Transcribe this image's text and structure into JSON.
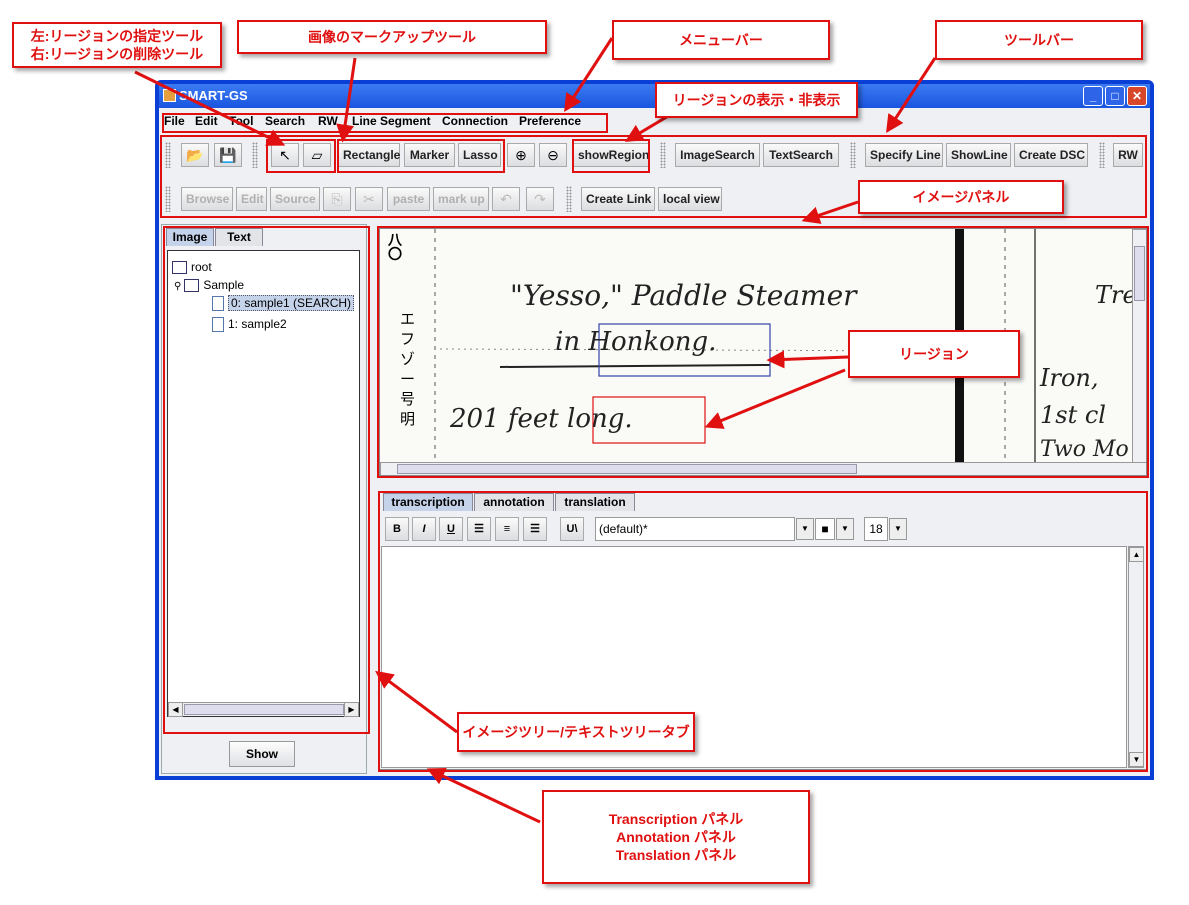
{
  "window": {
    "title": "SMART-GS"
  },
  "menu": [
    "File",
    "Edit",
    "Tool",
    "Search",
    "RW",
    "Line Segment",
    "Connection",
    "Preference"
  ],
  "toolbar1": {
    "rectangle": "Rectangle",
    "marker": "Marker",
    "lasso": "Lasso",
    "show_region": "showRegion",
    "image_search": "ImageSearch",
    "text_search": "TextSearch",
    "specify_line": "Specify Line",
    "show_line": "ShowLine",
    "create_dsc": "Create DSC",
    "rw": "RW"
  },
  "toolbar2": {
    "browse": "Browse",
    "edit": "Edit",
    "source": "Source",
    "paste": "paste",
    "mark_up": "mark up",
    "create_link": "Create Link",
    "local_view": "local view"
  },
  "left_tabs": [
    "Image",
    "Text"
  ],
  "tree": {
    "root": "root",
    "sample": "Sample",
    "items": [
      "0: sample1 (SEARCH)",
      "1: sample2"
    ]
  },
  "show_button": "Show",
  "image": {
    "line1": "\"Yesso,\" Paddle Steamer",
    "line2": "in Honkong.",
    "line3": "201 feet long.",
    "right1": "Tren",
    "right2": "Iron,",
    "right3": "1st cl",
    "right4": "Two Mo",
    "kana_left": "エフゾー号明",
    "number_top": "八〇"
  },
  "bottom_tabs": [
    "transcription",
    "annotation",
    "translation"
  ],
  "format": {
    "bold": "B",
    "italic": "I",
    "underline": "U",
    "unicode": "U\\",
    "font": "(default)*",
    "size": "18"
  },
  "annotations": {
    "region_tool": "左:リージョンの指定ツール\n右:リージョンの削除ツール",
    "markup_tool": "画像のマークアップツール",
    "menubar": "メニューバー",
    "toolbar": "ツールバー",
    "show_region": "リージョンの表示・非表示",
    "image_panel": "イメージパネル",
    "region": "リージョン",
    "tree_tabs": "イメージツリー/テキストツリータブ",
    "panels": "Transcription パネル\nAnnotation パネル\nTranslation パネル"
  },
  "colors": {
    "annotation_red": "#e01010",
    "title_blue": "#1a55e0"
  }
}
